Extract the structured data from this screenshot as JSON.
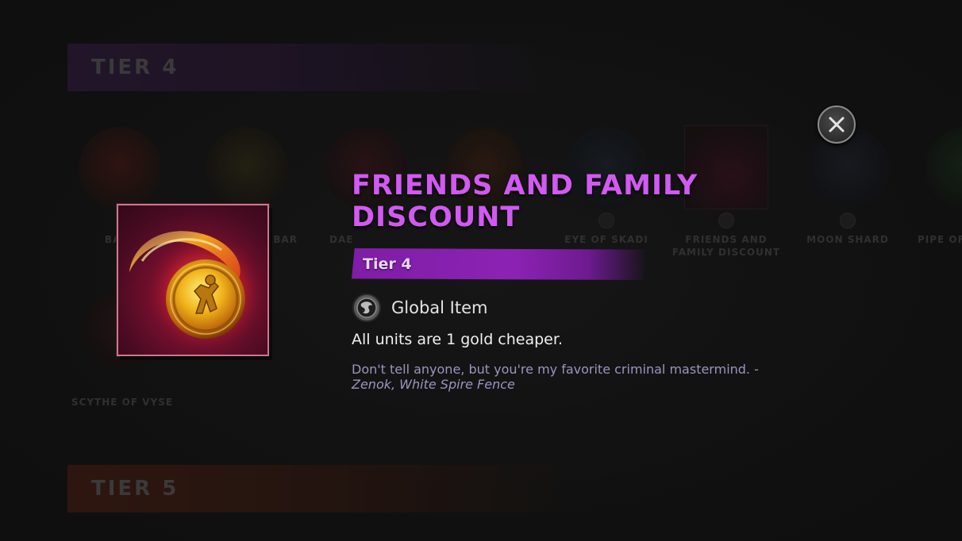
{
  "background": {
    "tier4_label": "TIER 4",
    "tier5_label": "TIER 5",
    "items": [
      {
        "label": "BATT",
        "color": "#5a1a14"
      },
      {
        "label": "BAR",
        "color": "#3e3416"
      },
      {
        "label": "DAE",
        "color": "#4a1418"
      },
      {
        "label": "",
        "color": "#4a2410"
      },
      {
        "label": "EYE OF SKADI",
        "color": "#1c2a38"
      },
      {
        "label": "FRIENDS AND FAMILY DISCOUNT",
        "color": "#4a1022"
      },
      {
        "label": "MOON SHARD",
        "color": "#242634"
      },
      {
        "label": "PIPE OF",
        "color": "#1e3a1e"
      },
      {
        "label": "SCYTHE OF VYSE",
        "color": "#3a1616"
      }
    ]
  },
  "popup": {
    "title": "FRIENDS AND FAMILY DISCOUNT",
    "tier": "Tier 4",
    "global_label": "Global Item",
    "description": "All units are 1 gold cheaper.",
    "lore_text": "Don't tell anyone, but you're my favorite criminal mastermind. -",
    "lore_author": "Zenok, White Spire Fence",
    "item_icon": "gold-coin-icon",
    "global_icon": "globe-icon",
    "close_icon": "close-icon"
  },
  "colors": {
    "title": "#d259f2",
    "tier_bar": "#8c22b4",
    "frame_border": "#c9788e",
    "lore": "#9a95bf"
  }
}
